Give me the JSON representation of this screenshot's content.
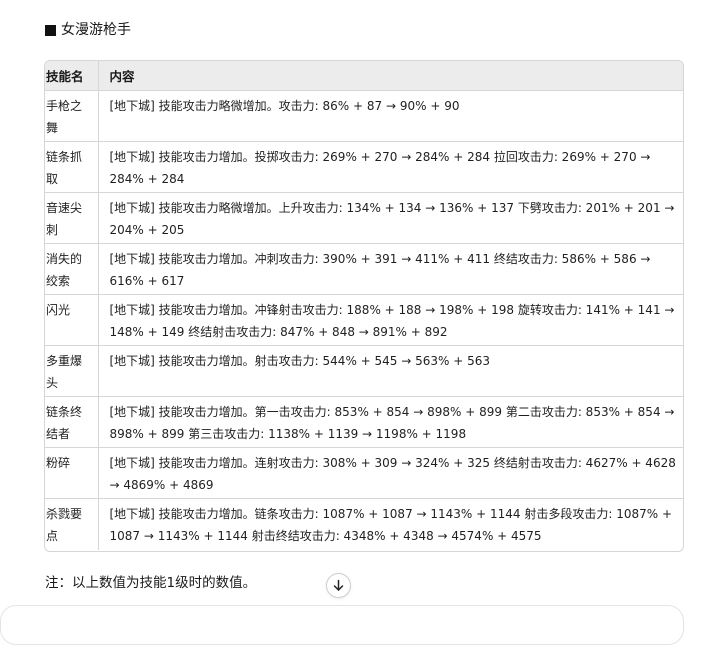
{
  "section": {
    "title": "女漫游枪手"
  },
  "table": {
    "headers": [
      "技能名",
      "内容"
    ],
    "rows": [
      {
        "name": "手枪之舞",
        "content": "[地下城] 技能攻击力略微增加。攻击力: 86% + 87 → 90% + 90"
      },
      {
        "name": "链条抓取",
        "content": "[地下城] 技能攻击力增加。投掷攻击力: 269% + 270 → 284% + 284 拉回攻击力: 269% + 270 → 284% + 284"
      },
      {
        "name": "音速尖刺",
        "content": "[地下城] 技能攻击力略微增加。上升攻击力: 134% + 134 → 136% + 137 下劈攻击力: 201% + 201 → 204% + 205"
      },
      {
        "name": "消失的绞索",
        "content": "[地下城] 技能攻击力增加。冲刺攻击力: 390% + 391 → 411% + 411 终结攻击力: 586% + 586 → 616% + 617"
      },
      {
        "name": "闪光",
        "content": "[地下城] 技能攻击力增加。冲锋射击攻击力: 188% + 188 → 198% + 198 旋转攻击力: 141% + 141 → 148% + 149 终结射击攻击力: 847% + 848 → 891% + 892"
      },
      {
        "name": "多重爆头",
        "content": "[地下城] 技能攻击力增加。射击攻击力: 544% + 545 → 563% + 563"
      },
      {
        "name": "链条终结者",
        "content": "[地下城] 技能攻击力增加。第一击攻击力: 853% + 854 → 898% + 899 第二击攻击力: 853% + 854 → 898% + 899 第三击攻击力: 1138% + 1139 → 1198% + 1198"
      },
      {
        "name": "粉碎",
        "content": "[地下城] 技能攻击力增加。连射攻击力: 308% + 309 → 324% + 325 终结射击攻击力: 4627% + 4628 → 4869% + 4869"
      },
      {
        "name": "杀戮要点",
        "content": "[地下城] 技能攻击力增加。链条攻击力: 1087% + 1087 → 1143% + 1144 射击多段攻击力: 1087% + 1087 → 1143% + 1144 射击终结攻击力: 4348% + 4348 → 4574% + 4575"
      }
    ]
  },
  "footnote": "注：以上数值为技能1级时的数值。",
  "icons": {
    "heading_bullet": "black-square-icon",
    "scroll": "arrow-down-icon"
  }
}
